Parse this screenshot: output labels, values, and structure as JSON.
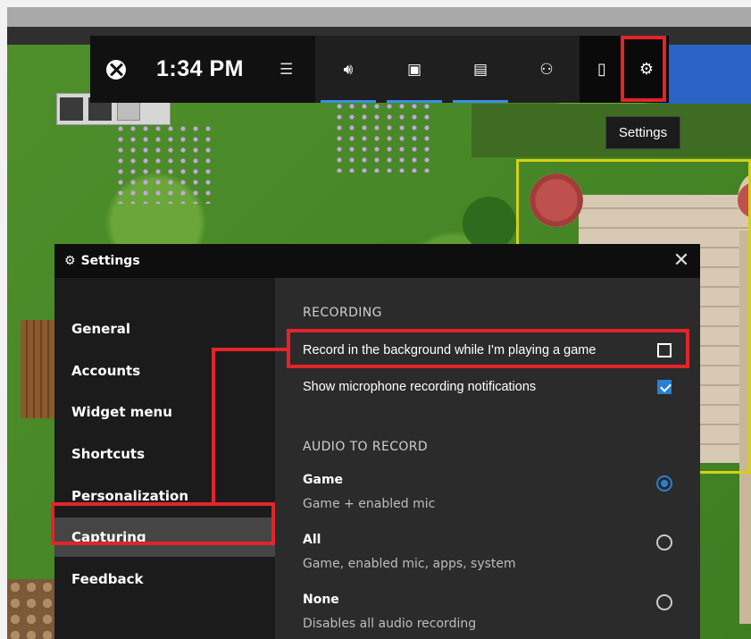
{
  "gamebar": {
    "time": "1:34 PM",
    "icons": {
      "xbox": "xbox-logo-icon",
      "menu": "widget-menu-icon",
      "audio": "audio-icon",
      "capture": "capture-icon",
      "performance": "performance-icon",
      "social": "social-icon",
      "mouse": "mouse-icon",
      "settings": "gear-icon"
    },
    "tooltip": "Settings"
  },
  "settings_window": {
    "title": "Settings",
    "nav": [
      "General",
      "Accounts",
      "Widget menu",
      "Shortcuts",
      "Personalization",
      "Capturing",
      "Feedback"
    ],
    "selected_nav": "Capturing",
    "recording": {
      "heading": "RECORDING",
      "background_label": "Record in the background while I'm playing a game",
      "background_checked": false,
      "mic_notif_label": "Show microphone recording notifications",
      "mic_notif_checked": true
    },
    "audio": {
      "heading": "AUDIO TO RECORD",
      "options": [
        {
          "title": "Game",
          "subtitle": "Game + enabled mic",
          "selected": true
        },
        {
          "title": "All",
          "subtitle": "Game, enabled mic, apps, system",
          "selected": false
        },
        {
          "title": "None",
          "subtitle": "Disables all audio recording",
          "selected": false
        }
      ]
    }
  },
  "colors": {
    "annotation": "#e3242b",
    "accent": "#2a7fd4"
  }
}
